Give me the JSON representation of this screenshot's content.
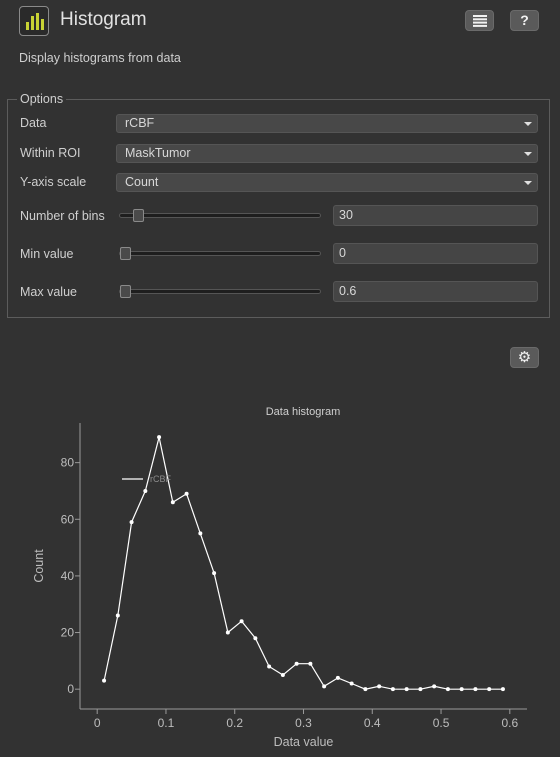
{
  "header": {
    "title": "Histogram",
    "description": "Display histograms from data",
    "menu_icon": "list-icon",
    "help_label": "?",
    "app_icon": "bar-chart-icon"
  },
  "options": {
    "legend": "Options",
    "data": {
      "label": "Data",
      "value": "rCBF"
    },
    "within_roi": {
      "label": "Within ROI",
      "value": "MaskTumor"
    },
    "y_axis_scale": {
      "label": "Y-axis scale",
      "value": "Count"
    },
    "number_of_bins": {
      "label": "Number of bins",
      "value": "30",
      "slider_fraction": 0.07
    },
    "min_value": {
      "label": "Min value",
      "value": "0",
      "slider_fraction": 0
    },
    "max_value": {
      "label": "Max value",
      "value": "0.6",
      "slider_fraction": 0
    }
  },
  "settings_icon": "gear-icon",
  "colors": {
    "background": "#323232",
    "line": "#ffffff",
    "accent_icon": "#c8d234"
  },
  "chart_data": {
    "type": "line",
    "title": "Data histogram",
    "xlabel": "Data value",
    "ylabel": "Count",
    "xlim": [
      -0.025,
      0.625
    ],
    "ylim": [
      -7,
      94
    ],
    "xticks": [
      0,
      0.1,
      0.2,
      0.3,
      0.4,
      0.5,
      0.6
    ],
    "xtick_labels": [
      "0",
      "0.1",
      "0.2",
      "0.3",
      "0.4",
      "0.5",
      "0.6"
    ],
    "yticks": [
      0,
      20,
      40,
      60,
      80
    ],
    "ytick_labels": [
      "0",
      "20",
      "40",
      "60",
      "80"
    ],
    "legend_position": "top-left",
    "series": [
      {
        "name": "rCBF",
        "x": [
          0.01,
          0.03,
          0.05,
          0.07,
          0.09,
          0.11,
          0.13,
          0.15,
          0.17,
          0.19,
          0.21,
          0.23,
          0.25,
          0.27,
          0.29,
          0.31,
          0.33,
          0.35,
          0.37,
          0.39,
          0.41,
          0.43,
          0.45,
          0.47,
          0.49,
          0.51,
          0.53,
          0.55,
          0.57,
          0.59
        ],
        "y": [
          3,
          26,
          59,
          70,
          89,
          66,
          69,
          55,
          41,
          20,
          24,
          18,
          8,
          5,
          9,
          9,
          1,
          4,
          2,
          0,
          1,
          0,
          0,
          0,
          1,
          0,
          0,
          0,
          0,
          0
        ]
      }
    ]
  }
}
